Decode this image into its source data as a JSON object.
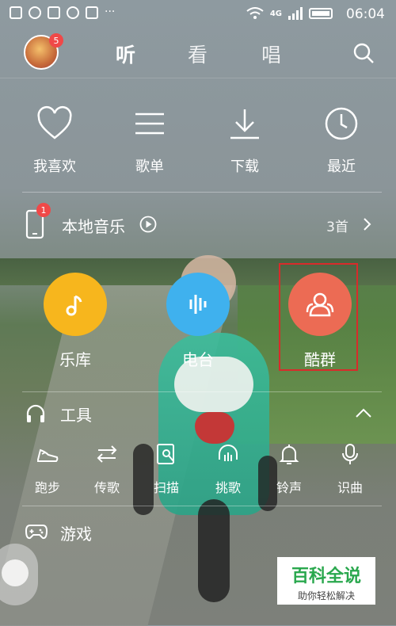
{
  "status_bar": {
    "time": "06:04",
    "network": "4G"
  },
  "top_nav": {
    "avatar_badge": "5",
    "tabs": [
      "听",
      "看",
      "唱"
    ],
    "active_tab": "听"
  },
  "quick_actions": [
    {
      "label": "我喜欢",
      "icon": "heart-icon"
    },
    {
      "label": "歌单",
      "icon": "list-icon"
    },
    {
      "label": "下载",
      "icon": "download-icon"
    },
    {
      "label": "最近",
      "icon": "clock-icon"
    }
  ],
  "local_music": {
    "label": "本地音乐",
    "badge": "1",
    "count": "3首"
  },
  "features": [
    {
      "label": "乐库",
      "color": "#f7b61d",
      "icon": "music-note-icon"
    },
    {
      "label": "电台",
      "color": "#3fb1ee",
      "icon": "radio-wave-icon"
    },
    {
      "label": "酷群",
      "color": "#ec6b54",
      "icon": "group-icon"
    }
  ],
  "tools": {
    "title": "工具",
    "items": [
      {
        "label": "跑步",
        "icon": "shoe-icon"
      },
      {
        "label": "传歌",
        "icon": "transfer-icon"
      },
      {
        "label": "扫描",
        "icon": "scan-icon"
      },
      {
        "label": "挑歌",
        "icon": "headphone-icon"
      },
      {
        "label": "铃声",
        "icon": "bell-icon"
      },
      {
        "label": "识曲",
        "icon": "mic-icon"
      }
    ]
  },
  "games": {
    "title": "游戏"
  },
  "watermark": {
    "title": "百科全说",
    "subtitle": "助你轻松解决"
  }
}
